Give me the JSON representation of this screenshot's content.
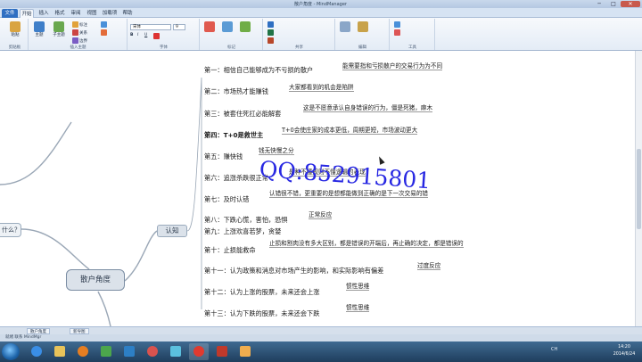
{
  "window": {
    "title": "散户角度 - MindManager",
    "min_label": "─",
    "max_label": "□",
    "close_label": "✕"
  },
  "ribbon_tabs": [
    "文件",
    "开始",
    "插入",
    "格式",
    "审阅",
    "视图",
    "加载项",
    "帮助"
  ],
  "ribbon": {
    "clipboard": {
      "paste": "粘贴",
      "label": "剪贴板"
    },
    "insert": {
      "topic": "主题",
      "subtopic": "子主题",
      "callout": "标注",
      "relationship": "关系",
      "boundary": "边界",
      "label": "插入主题"
    },
    "font": {
      "name": "宋体",
      "size": "9",
      "label": "字体"
    },
    "markers": {
      "label": "标记"
    },
    "editing": {
      "label": "编辑"
    },
    "tools": {
      "label": "工具"
    },
    "sharing": {
      "label": "共享"
    }
  },
  "map": {
    "center": "散户角度",
    "branch": "认知",
    "left_node": "什么？",
    "topics": [
      {
        "label": "第一：相信自己能够成为不亏损的散户",
        "note": "能需要指和亏损散户的交易行为为不同"
      },
      {
        "label": "第二：市场热才能赚钱",
        "note": "大家都看到的机会是陷阱"
      },
      {
        "label": "第三：被套住死扛必能解套",
        "note": "这是不愿意承认自身错误的行为，僵是死猪，麻木"
      },
      {
        "label": "第四：T+0是救世主",
        "note": "T+0会使庄家的成本更低，周期更短，市场波动更大"
      },
      {
        "label": "第五：赚快钱",
        "note": "钱无快慢之分"
      },
      {
        "label": "第六：追涨杀跌很正常",
        "note": "是种不懂规则不懂逻辑的表现"
      },
      {
        "label": "第七：及时认错",
        "note": "认错很不错，更重要的是想都能做到正确的是下一次交易的错"
      },
      {
        "label": "第八：下跌心慌，害怕，恐惧",
        "note": "正常反应"
      },
      {
        "label": "第九：上涨欢喜若梦，贪婪",
        "note": ""
      },
      {
        "label": "第十：止损能救命",
        "note": "止损和割肉没有多大区别，都是错误的开端后，再止确的决定，都是错误的"
      },
      {
        "label": "第十一：认为政策和消息对市场产生的影响，和实际影响有偏差",
        "note": "过度反应"
      },
      {
        "label": "第十二：认为上涨的股票，未来还会上涨",
        "note": "惯性思维"
      },
      {
        "label": "第十三：认为下跌的股票，未来还会下跌",
        "note": "惯性思维"
      }
    ],
    "watermark": "QQ:852915801"
  },
  "sheets": [
    "散户角度",
    "新导图"
  ],
  "status_text": "就绪 联系 MindMgr",
  "tray": {
    "language": "CH",
    "time": "14:20",
    "date": "2014/6/24"
  },
  "colors": {
    "accent": "#2f6fc2",
    "watermark": "#2727e2",
    "node_fill": "#dbe2ea"
  }
}
